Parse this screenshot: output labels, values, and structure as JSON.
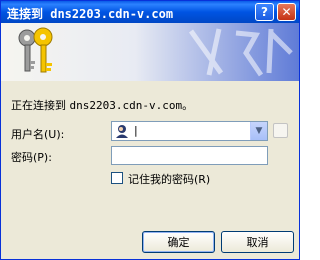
{
  "window": {
    "title": "连接到 dns2203.cdn-v.com"
  },
  "titlebar": {
    "help_label": "?",
    "close_label": "✕"
  },
  "connecting": {
    "prefix": "正在连接到 ",
    "host": "dns2203.cdn-v.com",
    "suffix": "。"
  },
  "form": {
    "username_label": "用户名(U):",
    "username_value": "|",
    "password_label": "密码(P):",
    "remember_label": "记住我的密码(R)"
  },
  "buttons": {
    "ok": "确定",
    "cancel": "取消"
  },
  "colors": {
    "titlebar": "#0054e3",
    "dialog_bg": "#ece9d8",
    "close": "#c53214"
  }
}
